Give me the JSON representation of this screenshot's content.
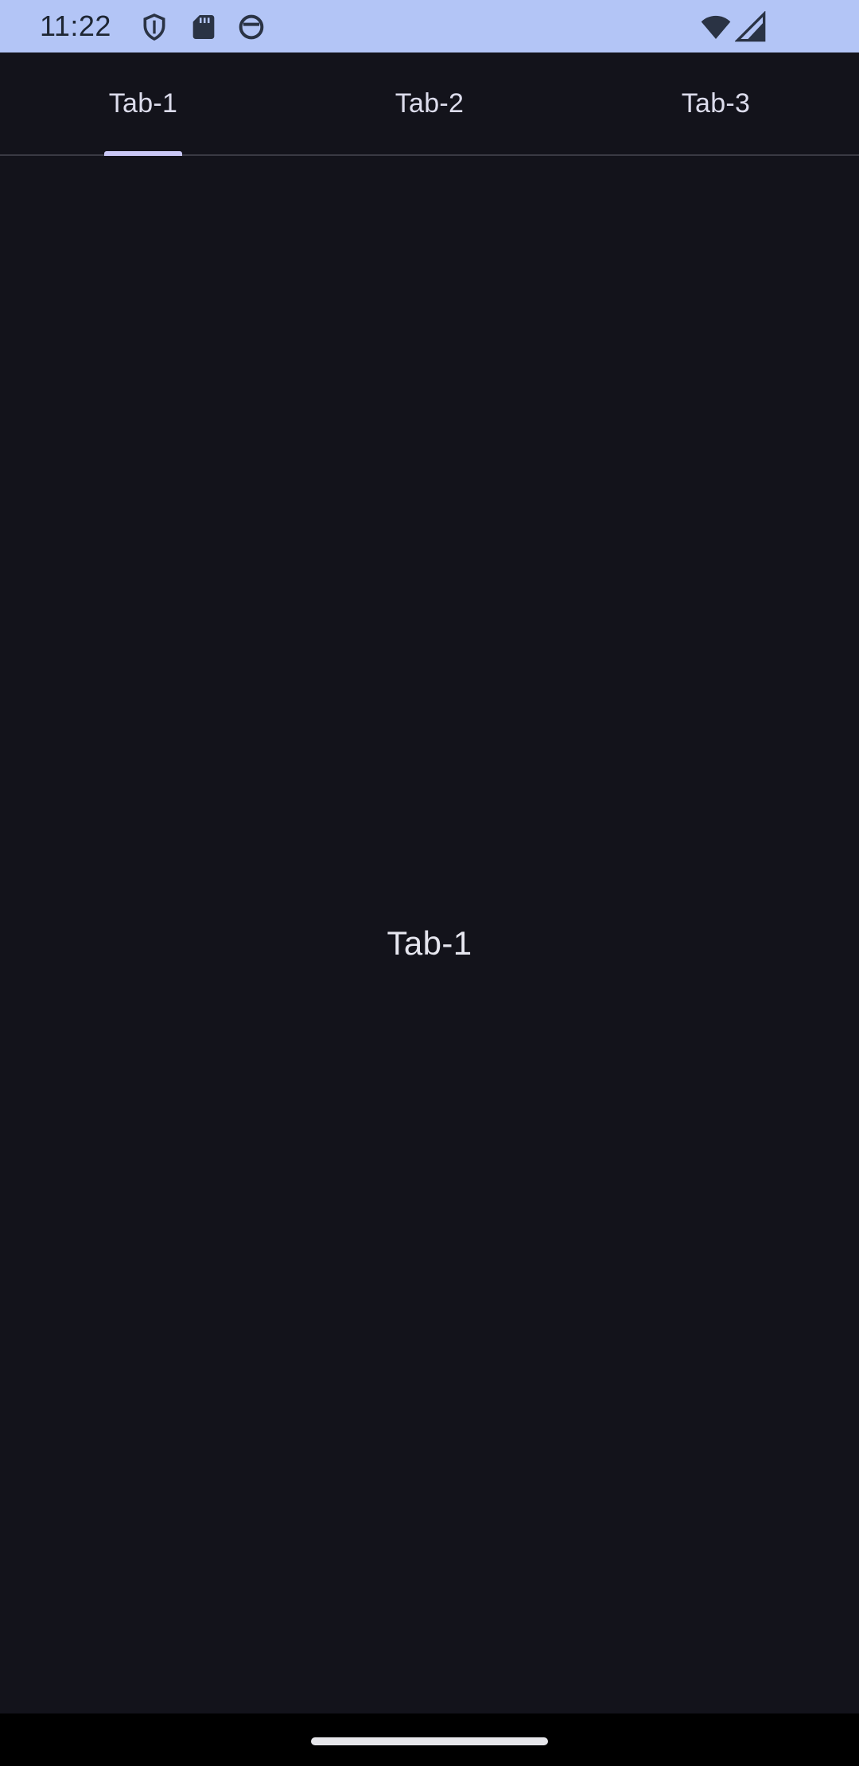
{
  "status_bar": {
    "time": "11:22",
    "background_color": "#b3c5f6",
    "icons": [
      "shield-icon",
      "sd-card-icon",
      "sync-icon",
      "wifi-icon",
      "cell-signal-icon"
    ]
  },
  "tabs": [
    {
      "label": "Tab-1",
      "selected": true
    },
    {
      "label": "Tab-2",
      "selected": false
    },
    {
      "label": "Tab-3",
      "selected": false
    }
  ],
  "content": {
    "text": "Tab-1"
  },
  "colors": {
    "background": "#13131b",
    "indicator": "#c9c7f5",
    "tab_text": "#dcdcec"
  }
}
